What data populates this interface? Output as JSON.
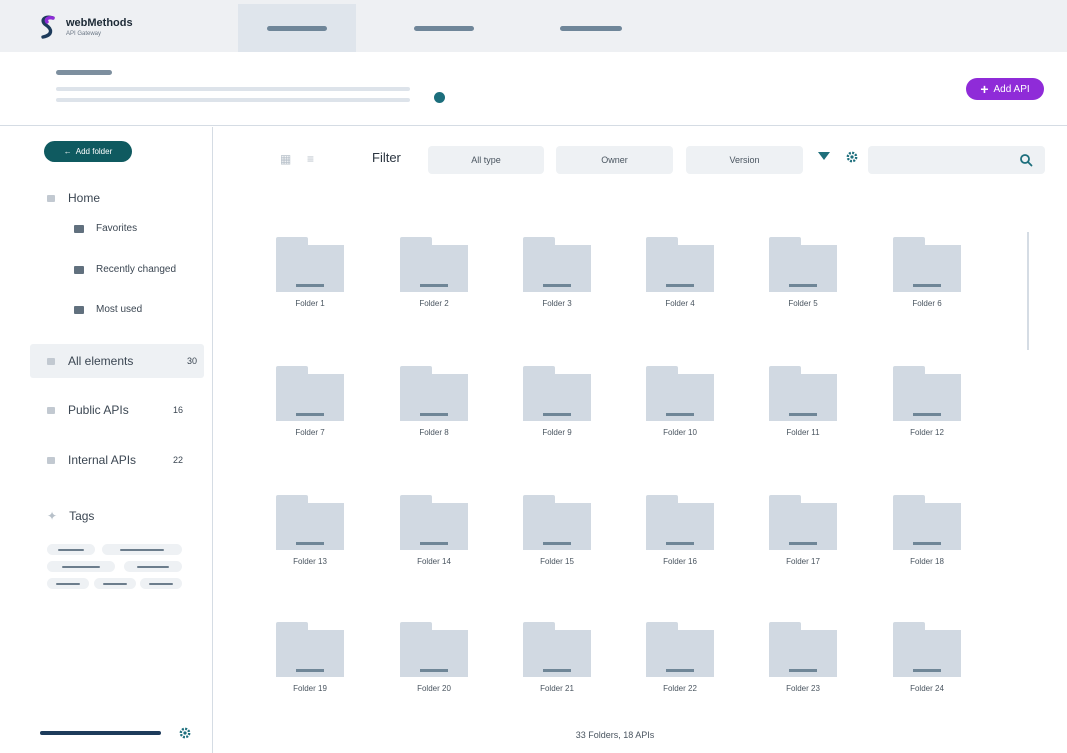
{
  "brand": {
    "name": "webMethods",
    "subtitle": "API Gateway",
    "colors": [
      "#8f2bd8",
      "#1c6e7c",
      "#1d3b5b"
    ]
  },
  "top_tabs": [
    {
      "active": true,
      "icon": "tab-label-placeholder"
    },
    {
      "active": false,
      "icon": "tab-label-placeholder"
    },
    {
      "active": false,
      "icon": "tab-label-placeholder"
    }
  ],
  "header": {
    "add_api_label": "Add API",
    "accent": "#8f2bd8"
  },
  "sidebar": {
    "add_folder_label": "Add folder",
    "home_label": "Home",
    "sub_items": [
      {
        "label": "Favorites"
      },
      {
        "label": "Recently changed"
      },
      {
        "label": "Most used"
      }
    ],
    "groups": [
      {
        "label": "All elements",
        "count": "30"
      },
      {
        "label": "Public APIs",
        "count": "16"
      },
      {
        "label": "Internal APIs",
        "count": "22"
      }
    ],
    "tags_label": "Tags"
  },
  "toolbar": {
    "filter_label": "Filter",
    "filters": [
      "All type",
      "Owner",
      "Version"
    ],
    "search_placeholder": ""
  },
  "folders": [
    "Folder 1",
    "Folder 2",
    "Folder 3",
    "Folder 4",
    "Folder 5",
    "Folder 6",
    "Folder 7",
    "Folder 8",
    "Folder 9",
    "Folder 10",
    "Folder 11",
    "Folder 12",
    "Folder 13",
    "Folder 14",
    "Folder 15",
    "Folder 16",
    "Folder 17",
    "Folder 18",
    "Folder 19",
    "Folder 20",
    "Folder 21",
    "Folder 22",
    "Folder 23",
    "Folder 24"
  ],
  "summary": "33 Folders, 18 APIs"
}
